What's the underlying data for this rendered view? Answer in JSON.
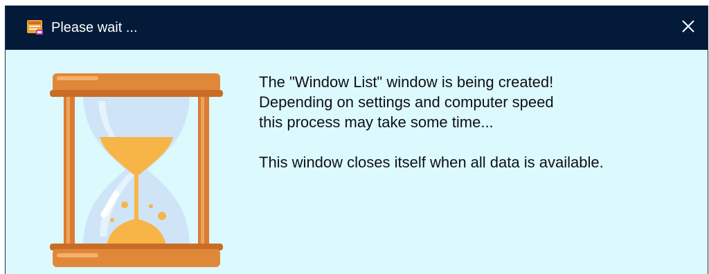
{
  "window": {
    "title": "Please wait ...",
    "app_icon": "app-window-icon",
    "close_icon": "close-icon"
  },
  "content": {
    "illustration": "hourglass-icon",
    "message_lines": [
      "The \"Window List\" window is being created!",
      "Depending on settings and computer speed",
      "this process may take some time...",
      "This window closes itself when all data is available."
    ]
  },
  "colors": {
    "titlebar_background": "#031b38",
    "content_background": "#dcf9fd",
    "hourglass_frame": "#e0883a",
    "sand": "#f7b548"
  }
}
